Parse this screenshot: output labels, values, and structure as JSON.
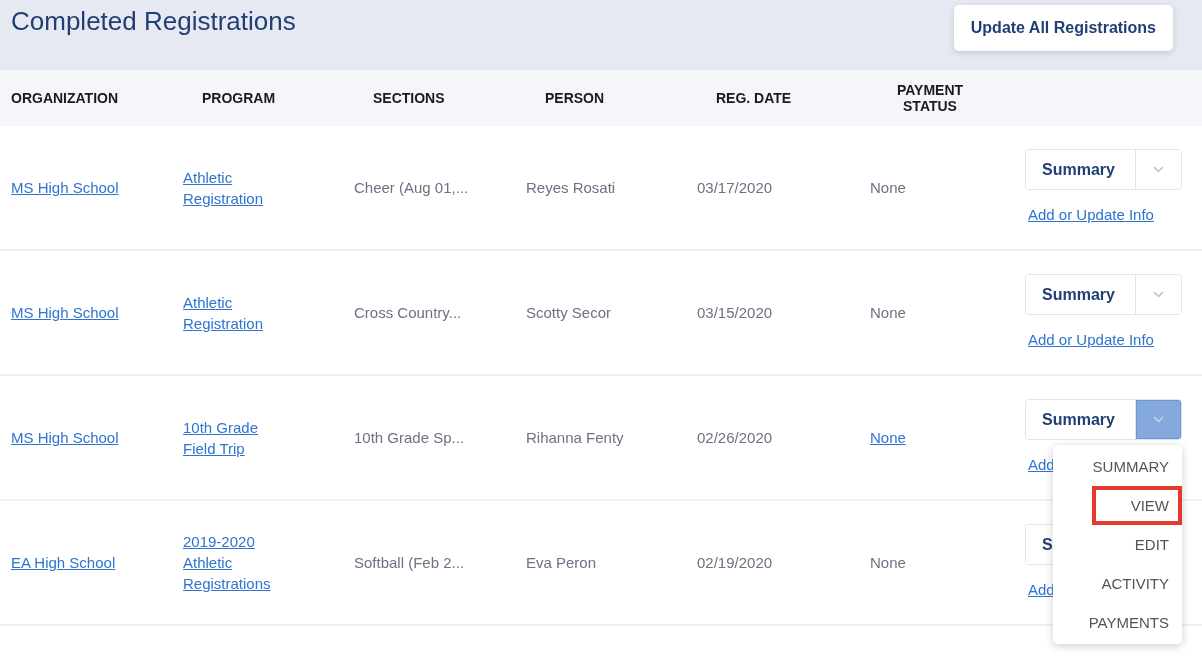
{
  "page": {
    "title": "Completed Registrations",
    "action_button": "Update All Registrations"
  },
  "table": {
    "columns": [
      "ORGANIZATION",
      "PROGRAM",
      "SECTIONS",
      "PERSON",
      "REG. DATE",
      "PAYMENT STATUS"
    ],
    "rows": [
      {
        "organization": "MS High School",
        "program": "Athletic Registration",
        "sections": "Cheer (Aug 01,...",
        "person": "Reyes Rosati",
        "reg_date": "03/17/2020",
        "payment_status": "None",
        "payment_link": false,
        "action": "Summary",
        "expanded": false,
        "info_link": "Add or Update Info"
      },
      {
        "organization": "MS High School",
        "program": "Athletic Registration",
        "sections": "Cross Country...",
        "person": "Scotty Secor",
        "reg_date": "03/15/2020",
        "payment_status": "None",
        "payment_link": false,
        "action": "Summary",
        "expanded": false,
        "info_link": "Add or Update Info"
      },
      {
        "organization": "MS High School",
        "program": "10th Grade Field Trip",
        "sections": "10th Grade Sp...",
        "person": "Rihanna Fenty",
        "reg_date": "02/26/2020",
        "payment_status": "None",
        "payment_link": true,
        "action": "Summary",
        "expanded": true,
        "info_link": "Add",
        "menu": [
          {
            "label": "SUMMARY",
            "selected": false
          },
          {
            "label": "VIEW",
            "selected": true
          },
          {
            "label": "EDIT",
            "selected": false
          },
          {
            "label": "ACTIVITY",
            "selected": false
          },
          {
            "label": "PAYMENTS",
            "selected": false
          }
        ]
      },
      {
        "organization": "EA High School",
        "program": "2019-2020 Athletic Registrations",
        "sections": "Softball (Feb 2...",
        "person": "Eva Peron",
        "reg_date": "02/19/2020",
        "payment_status": "None",
        "payment_link": false,
        "action": "S",
        "info_link": "Add"
      }
    ]
  }
}
